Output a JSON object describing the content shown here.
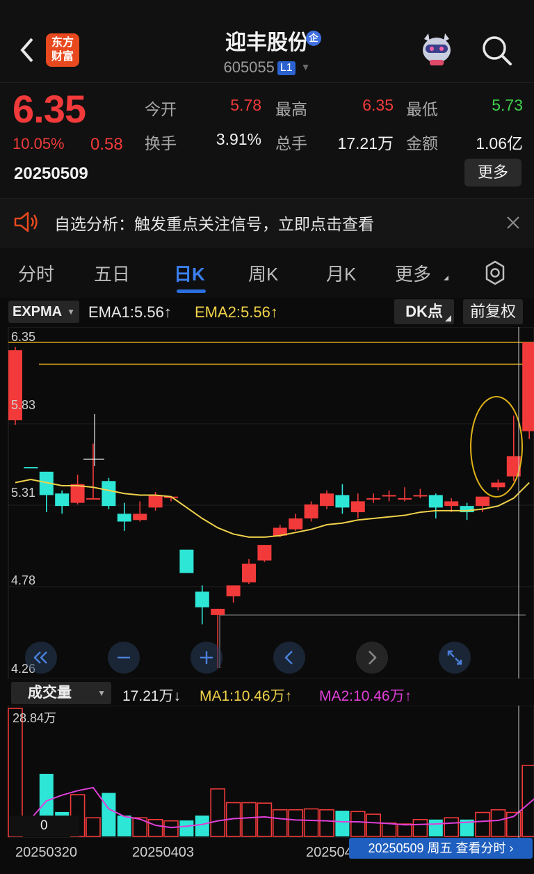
{
  "header": {
    "logo_line1": "东方",
    "logo_line2": "财富",
    "stock_name": "迎丰股份",
    "qi_badge": "企",
    "stock_code": "605055",
    "level_badge": "L1"
  },
  "quote": {
    "price": "6.35",
    "change_pct": "10.05%",
    "change": "0.58",
    "date": "20250509",
    "open_label": "今开",
    "open": "5.78",
    "high_label": "最高",
    "high": "6.35",
    "low_label": "最低",
    "low": "5.73",
    "turnover_label": "换手",
    "turnover": "3.91%",
    "volume_label": "总手",
    "volume": "17.21万",
    "amount_label": "金额",
    "amount": "1.06亿",
    "more_button": "更多",
    "colors": {
      "up": "#f23a3a",
      "down": "#2ee6d6",
      "low": "#3fd04a"
    }
  },
  "notice": {
    "text": "自选分析：触发重点关注信号，立即点击查看",
    "icon": "speaker-icon"
  },
  "tabs": {
    "items": [
      "分时",
      "五日",
      "日K",
      "周K",
      "月K",
      "更多"
    ],
    "active": "日K"
  },
  "indicator": {
    "selector": "EXPMA",
    "ema1": "EMA1:5.56↑",
    "ema2": "EMA2:5.56↑",
    "dk_button": "DK点",
    "adjust_button": "前复权"
  },
  "kline": {
    "y_labels": [
      "6.35",
      "5.83",
      "5.31",
      "4.78",
      "4.26"
    ],
    "ymax": 6.35,
    "ymin": 4.26
  },
  "volume": {
    "selector": "成交量",
    "value": "17.21万↓",
    "ma1": "MA1:10.46万↑",
    "ma2": "MA2:10.46万↑",
    "max_label": "28.84万",
    "zero_label": "0"
  },
  "chart_data": {
    "type": "candlestick",
    "x_ticks": [
      "20250320",
      "20250403",
      "20250509"
    ],
    "candles": [
      {
        "o": 5.85,
        "c": 6.3,
        "h": 6.32,
        "l": 5.82
      },
      {
        "o": 5.55,
        "c": 5.55,
        "h": 5.55,
        "l": 5.55
      },
      {
        "o": 5.52,
        "c": 5.37,
        "h": 5.52,
        "l": 5.26
      },
      {
        "o": 5.38,
        "c": 5.3,
        "h": 5.4,
        "l": 5.25
      },
      {
        "o": 5.32,
        "c": 5.44,
        "h": 5.5,
        "l": 5.31
      },
      {
        "o": 5.35,
        "c": 5.35,
        "h": 5.7,
        "l": 5.35
      },
      {
        "o": 5.46,
        "c": 5.3,
        "h": 5.48,
        "l": 5.28
      },
      {
        "o": 5.25,
        "c": 5.2,
        "h": 5.32,
        "l": 5.14
      },
      {
        "o": 5.21,
        "c": 5.25,
        "h": 5.33,
        "l": 5.2
      },
      {
        "o": 5.29,
        "c": 5.37,
        "h": 5.39,
        "l": 5.27
      },
      {
        "o": 5.36,
        "c": 5.36,
        "h": 5.36,
        "l": 5.33
      },
      {
        "o": 5.02,
        "c": 4.87,
        "h": 5.02,
        "l": 4.87
      },
      {
        "o": 4.75,
        "c": 4.65,
        "h": 4.79,
        "l": 4.54
      },
      {
        "o": 4.6,
        "c": 4.64,
        "h": 4.64,
        "l": 4.26
      },
      {
        "o": 4.72,
        "c": 4.79,
        "h": 4.79,
        "l": 4.68
      },
      {
        "o": 4.81,
        "c": 4.93,
        "h": 4.96,
        "l": 4.8
      },
      {
        "o": 4.95,
        "c": 5.05,
        "h": 5.05,
        "l": 4.94
      },
      {
        "o": 5.11,
        "c": 5.16,
        "h": 5.18,
        "l": 5.1
      },
      {
        "o": 5.15,
        "c": 5.22,
        "h": 5.25,
        "l": 5.14
      },
      {
        "o": 5.22,
        "c": 5.31,
        "h": 5.33,
        "l": 5.2
      },
      {
        "o": 5.3,
        "c": 5.38,
        "h": 5.4,
        "l": 5.28
      },
      {
        "o": 5.37,
        "c": 5.29,
        "h": 5.44,
        "l": 5.25
      },
      {
        "o": 5.26,
        "c": 5.33,
        "h": 5.38,
        "l": 5.22
      },
      {
        "o": 5.35,
        "c": 5.35,
        "h": 5.38,
        "l": 5.32
      },
      {
        "o": 5.37,
        "c": 5.37,
        "h": 5.4,
        "l": 5.33
      },
      {
        "o": 5.35,
        "c": 5.35,
        "h": 5.42,
        "l": 5.33
      },
      {
        "o": 5.37,
        "c": 5.37,
        "h": 5.41,
        "l": 5.35
      },
      {
        "o": 5.37,
        "c": 5.29,
        "h": 5.38,
        "l": 5.22
      },
      {
        "o": 5.3,
        "c": 5.33,
        "h": 5.35,
        "l": 5.26
      },
      {
        "o": 5.3,
        "c": 5.26,
        "h": 5.32,
        "l": 5.21
      },
      {
        "o": 5.3,
        "c": 5.36,
        "h": 5.36,
        "l": 5.26
      },
      {
        "o": 5.42,
        "c": 5.45,
        "h": 5.47,
        "l": 5.4
      },
      {
        "o": 5.49,
        "c": 5.62,
        "h": 5.88,
        "l": 5.46
      },
      {
        "o": 5.78,
        "c": 6.35,
        "h": 6.35,
        "l": 5.73
      }
    ],
    "ema": [
      5.45,
      5.47,
      5.45,
      5.43,
      5.43,
      5.42,
      5.4,
      5.38,
      5.37,
      5.37,
      5.36,
      5.29,
      5.22,
      5.16,
      5.12,
      5.1,
      5.1,
      5.11,
      5.13,
      5.15,
      5.18,
      5.19,
      5.21,
      5.22,
      5.23,
      5.24,
      5.26,
      5.27,
      5.27,
      5.27,
      5.28,
      5.3,
      5.35,
      5.45
    ],
    "volume": [
      28.84,
      1.0,
      14.1,
      5.5,
      9.4,
      4.2,
      9.8,
      4.7,
      4.2,
      3.8,
      3.5,
      3.6,
      4.7,
      10.7,
      7.6,
      7.6,
      7.5,
      6.0,
      6.0,
      6.2,
      6.0,
      5.8,
      5.6,
      5.0,
      3.0,
      2.8,
      3.8,
      3.8,
      4.2,
      3.8,
      5.4,
      6.0,
      5.4,
      16.0,
      17.21
    ],
    "vol_ma": [
      1.8,
      4.0,
      8.0,
      9.3,
      10.3,
      11.0,
      6.2,
      4.5,
      3.9,
      2.5,
      2.0,
      2.3,
      2.7,
      3.5,
      4.0,
      4.2,
      4.4,
      4.0,
      3.7,
      3.6,
      3.5,
      3.3,
      3.3,
      3.1,
      2.9,
      2.6,
      2.7,
      2.8,
      3.0,
      3.2,
      3.4,
      3.6,
      4.5,
      7.5,
      10.46
    ]
  },
  "footer": {
    "x_labels": [
      "20250320",
      "20250403",
      "2025042",
      "2025050"
    ],
    "date_tip": "20250509 周五 查看分时"
  }
}
